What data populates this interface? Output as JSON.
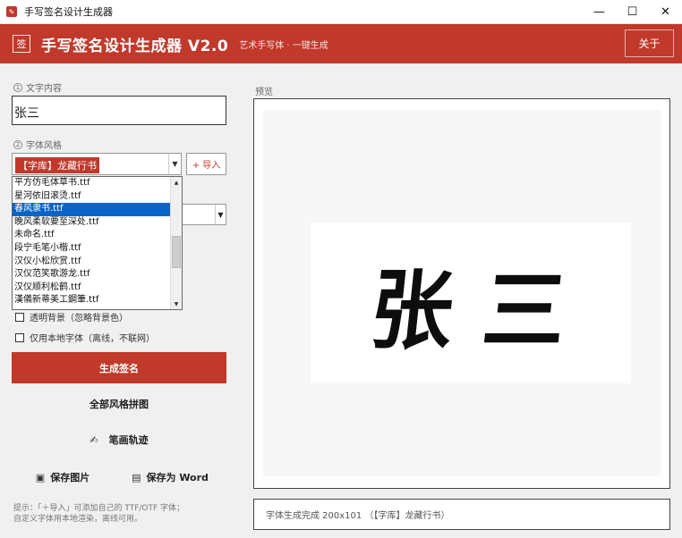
{
  "window": {
    "title": "手写签名设计生成器",
    "controls": [
      "—",
      "☐",
      "✕"
    ]
  },
  "header": {
    "logo_char": "签",
    "title": "手写签名设计生成器  V2.0",
    "subtitle": "艺术手写体 · 一键生成",
    "about_label": "关于",
    "accent_color": "#c0392b"
  },
  "left": {
    "text_section_num": "1",
    "text_section_label": "文字内容",
    "text_value": "张三",
    "style_section_num": "2",
    "style_section_label": "字体风格",
    "selected_font": "【字库】龙藏行书",
    "import_label": "+ 导入",
    "font_options": [
      "平方仿毛体草书.ttf",
      "星河依旧滚烫.ttf",
      "春风隶书.ttf",
      "晚风柔软要至深处.ttf",
      "未命名.ttf",
      "段宁毛笔小楷.ttf",
      "汉仪小松欣赏.ttf",
      "汉仪范笑歌游龙.ttf",
      "汉仪顺利松鹤.ttf",
      "漢儀新蒂美工鋼筆.ttf"
    ],
    "highlighted_option_index": 2,
    "checkbox_transparent": "透明背景（忽略背景色）",
    "checkbox_local_only": "仅用本地字体（离线，不联网）",
    "generate_label": "生成签名",
    "all_styles_label": "全部风格拼图",
    "stroke_label": "笔画轨迹",
    "save_image_label": "保存图片",
    "save_word_label": "保存为 Word",
    "hint_line1": "提示：「＋导入」可添加自己的 TTF/OTF 字体；",
    "hint_line2": "自定义字体用本地渲染，离线可用。"
  },
  "right": {
    "preview_label": "预览",
    "signature_text": "张三",
    "status_text": "字体生成完成 200x101 （【字库】龙藏行书）"
  }
}
